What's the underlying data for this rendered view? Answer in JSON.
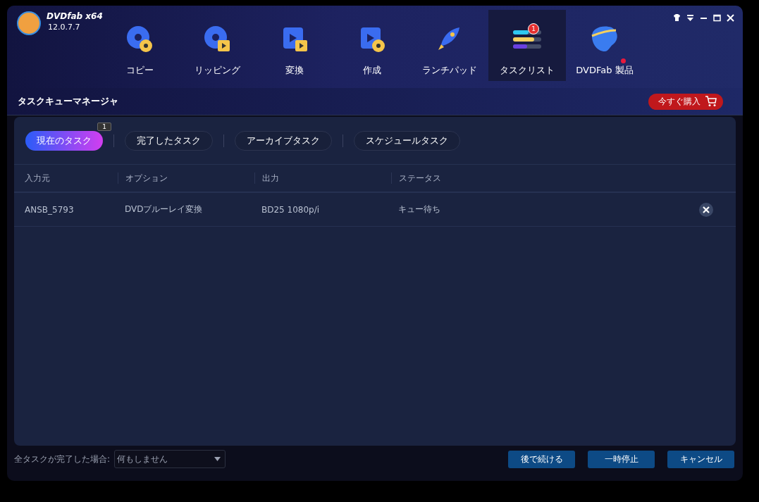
{
  "app": {
    "name": "DVDfab x64",
    "version": "12.0.7.7"
  },
  "nav": [
    {
      "label": "コピー",
      "kind": "disc",
      "selected": false
    },
    {
      "label": "リッピング",
      "kind": "disc-film",
      "selected": false
    },
    {
      "label": "変換",
      "kind": "film-film",
      "selected": false
    },
    {
      "label": "作成",
      "kind": "film-disc",
      "selected": false
    },
    {
      "label": "ランチパッド",
      "kind": "rocket",
      "selected": false
    },
    {
      "label": "タスクリスト",
      "kind": "list",
      "selected": true,
      "badge": "1"
    },
    {
      "label": "DVDFab 製品",
      "kind": "head",
      "selected": false,
      "notify_dot": true
    }
  ],
  "page_title": "タスクキューマネージャ",
  "buy_button": "今すぐ購入",
  "tabs": [
    {
      "label": "現在のタスク",
      "selected": true,
      "badge": "1"
    },
    {
      "label": "完了したタスク",
      "selected": false
    },
    {
      "label": "アーカイブタスク",
      "selected": false
    },
    {
      "label": "スケジュールタスク",
      "selected": false
    }
  ],
  "table": {
    "columns": [
      "入力元",
      "オプション",
      "出力",
      "ステータス"
    ],
    "rows": [
      {
        "cells": [
          "ANSB_5793",
          "DVDブルーレイ変換",
          "BD25 1080p/i",
          "キュー待ち"
        ]
      }
    ]
  },
  "footer": {
    "label": "全タスクが完了した場合:",
    "select": "何もしません",
    "buttons": [
      "後で続ける",
      "一時停止",
      "キャンセル"
    ]
  }
}
